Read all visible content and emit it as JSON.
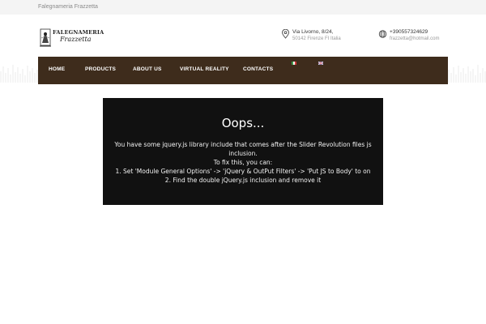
{
  "topbar": {
    "brand": "Falegnameria Frazzetta"
  },
  "logo": {
    "line1": "FALEGNAMERIA",
    "line2": "Frazzetta"
  },
  "contacts": {
    "address": {
      "line1": "Via Livorno, 8/24,",
      "line2": "50142 Firenze FI Italia",
      "icon": "location-pin-icon"
    },
    "phone": {
      "line1": "+390557324629",
      "line2": "frazzetta@hotmail.com",
      "icon": "globe-icon"
    }
  },
  "nav": {
    "items": [
      "HOME",
      "PRODUCTS",
      "ABOUT US",
      "VIRTUAL REALITY",
      "CONTACTS"
    ],
    "flags": [
      "italian-flag-icon",
      "uk-flag-icon"
    ],
    "background": "#3e2c1c"
  },
  "slider_error": {
    "title": "Oops...",
    "line1": "You have some jquery.js library include that comes after the Slider Revolution files js",
    "line2": "inclusion.",
    "line3": "To fix this, you can:",
    "line4": "1. Set 'Module General Options' -> 'jQuery & OutPut Filters' -> 'Put JS to Body' to on",
    "line5": "2. Find the double jQuery.js inclusion and remove it",
    "background": "#111111"
  }
}
